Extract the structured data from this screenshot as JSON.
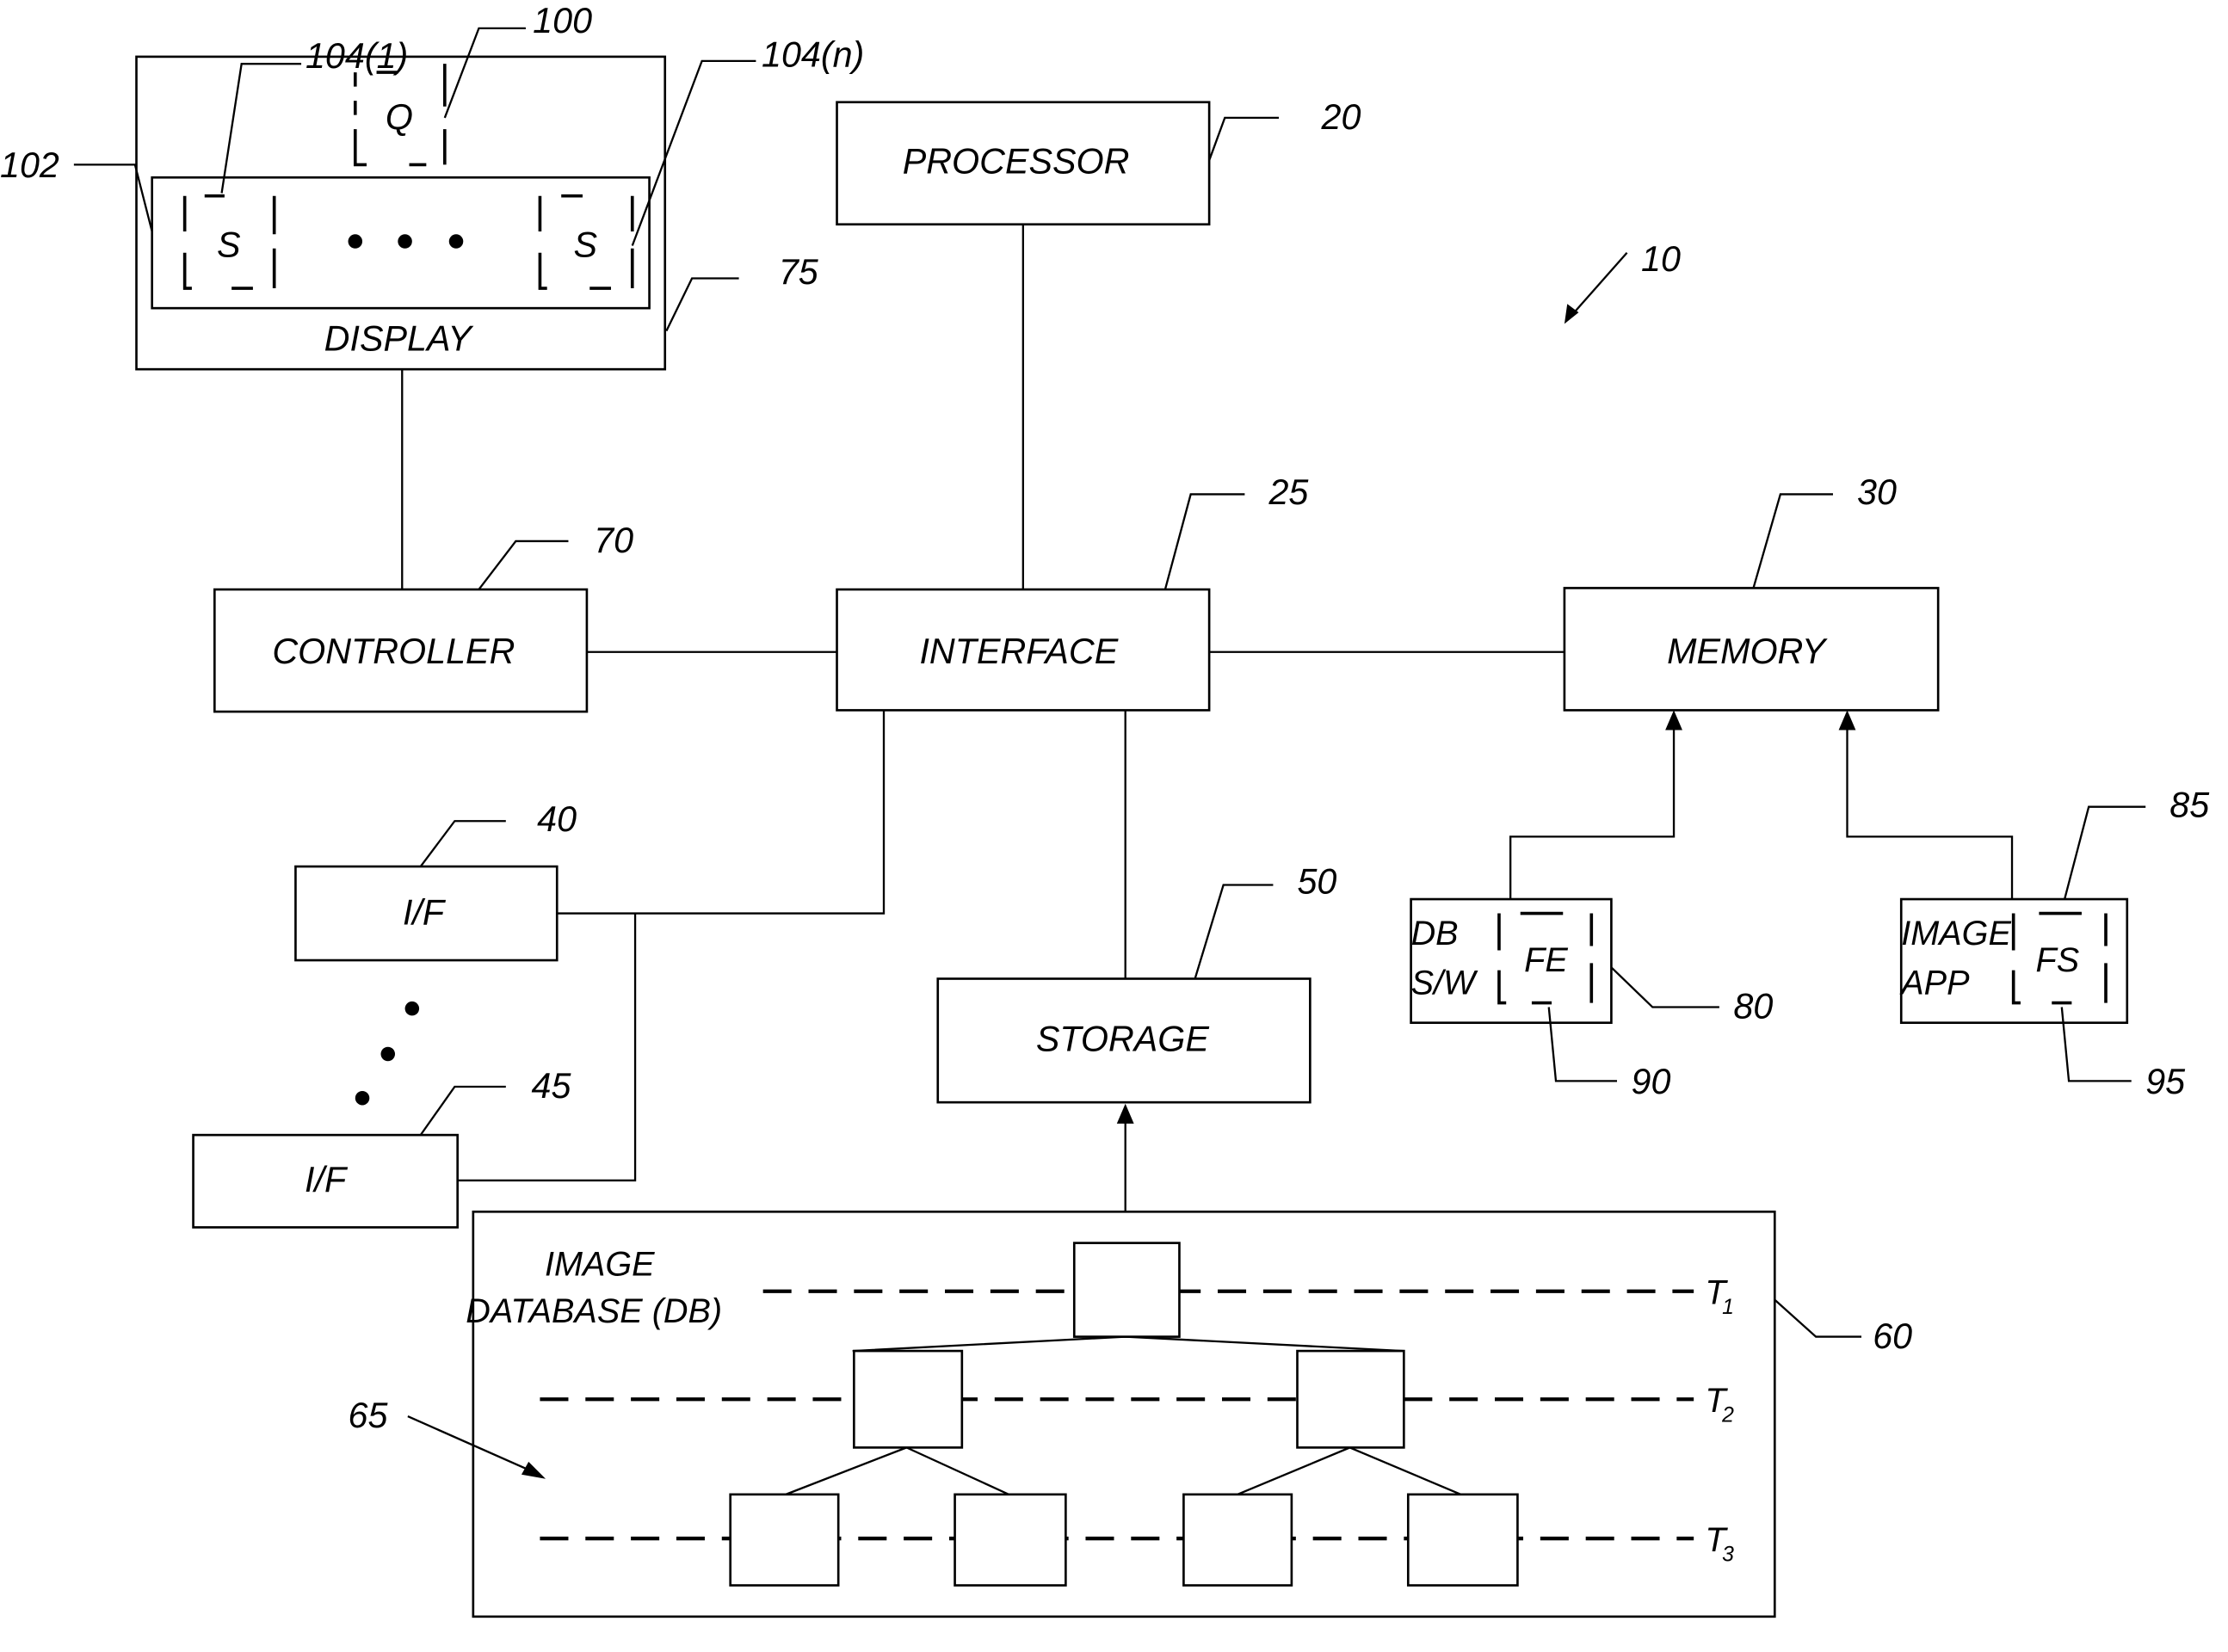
{
  "figure": {
    "system_ref": "10",
    "blocks": {
      "processor": {
        "label": "PROCESSOR",
        "ref": "20"
      },
      "interface": {
        "label": "INTERFACE",
        "ref": "25"
      },
      "memory": {
        "label": "MEMORY",
        "ref": "30"
      },
      "controller": {
        "label": "CONTROLLER",
        "ref": "70"
      },
      "display": {
        "label": "DISPLAY",
        "ref": "75"
      },
      "if1": {
        "label": "I/F",
        "ref": "40"
      },
      "if2": {
        "label": "I/F",
        "ref": "45"
      },
      "storage": {
        "label": "STORAGE",
        "ref": "50"
      },
      "db_sw": {
        "label_line1": "DB",
        "label_line2": "S/W",
        "ref": "80",
        "inner_label": "FE",
        "inner_ref": "90"
      },
      "image_app": {
        "label_line1": "IMAGE",
        "label_line2": "APP",
        "ref": "85",
        "inner_label": "FS",
        "inner_ref": "95"
      },
      "image_db": {
        "label_line1": "IMAGE",
        "label_line2": "DATABASE (DB)",
        "ref": "60",
        "tree_ref": "65",
        "levels": [
          {
            "T": "T",
            "sub": "1"
          },
          {
            "T": "T",
            "sub": "2"
          },
          {
            "T": "T",
            "sub": "3"
          }
        ]
      }
    },
    "display_content": {
      "query_label": "Q",
      "query_ref": "100",
      "strip_ref": "102",
      "first_item_label": "S",
      "first_item_ref": "104(1)",
      "last_item_label": "S",
      "last_item_ref": "104(n)"
    }
  }
}
